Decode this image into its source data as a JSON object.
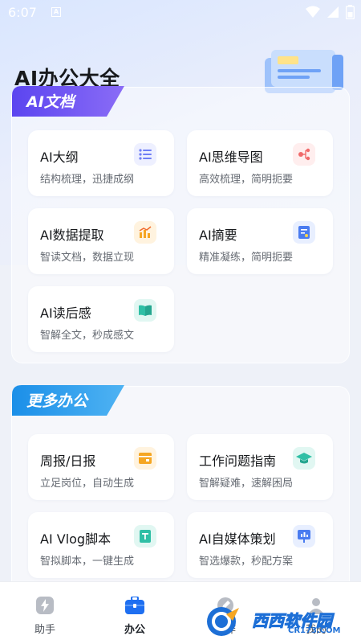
{
  "status_bar": {
    "time": "6:07"
  },
  "page_title": "AI办公大全",
  "sections": [
    {
      "title": "AI文档",
      "cards": [
        {
          "title": "AI大纲",
          "subtitle": "结构梳理，迅捷成纲",
          "icon": "list-icon",
          "icon_color": "#6f7ef5"
        },
        {
          "title": "AI思维导图",
          "subtitle": "高效梳理，简明扼要",
          "icon": "mindmap-icon",
          "icon_color": "#f06a6a"
        },
        {
          "title": "AI数据提取",
          "subtitle": "智读文档，数据立现",
          "icon": "bar-chart-icon",
          "icon_color": "#f5a623"
        },
        {
          "title": "AI摘要",
          "subtitle": "精准凝练，简明扼要",
          "icon": "document-edit-icon",
          "icon_color": "#4a7cf0"
        },
        {
          "title": "AI读后感",
          "subtitle": "智解全文，秒成感文",
          "icon": "book-icon",
          "icon_color": "#2fbfa5"
        }
      ]
    },
    {
      "title": "更多办公",
      "cards": [
        {
          "title": "周报/日报",
          "subtitle": "立足岗位，自动生成",
          "icon": "report-icon",
          "icon_color": "#f5a623"
        },
        {
          "title": "工作问题指南",
          "subtitle": "智解疑难，速解困局",
          "icon": "graduation-cap-icon",
          "icon_color": "#2fbfa5"
        },
        {
          "title": "AI Vlog脚本",
          "subtitle": "智拟脚本，一键生成",
          "icon": "script-icon",
          "icon_color": "#2fbfa5"
        },
        {
          "title": "AI自媒体策划",
          "subtitle": "智选爆款，秒配方案",
          "icon": "presentation-icon",
          "icon_color": "#4a7cf0"
        }
      ]
    }
  ],
  "tabbar": {
    "items": [
      {
        "label": "助手",
        "icon": "lightning-icon"
      },
      {
        "label": "办公",
        "icon": "briefcase-icon",
        "active": true
      },
      {
        "label": "创作",
        "icon": "pen-icon"
      },
      {
        "label": "我的",
        "icon": "user-icon"
      }
    ]
  },
  "watermark": {
    "text": "西西软件园",
    "url": "CR173.COM"
  }
}
